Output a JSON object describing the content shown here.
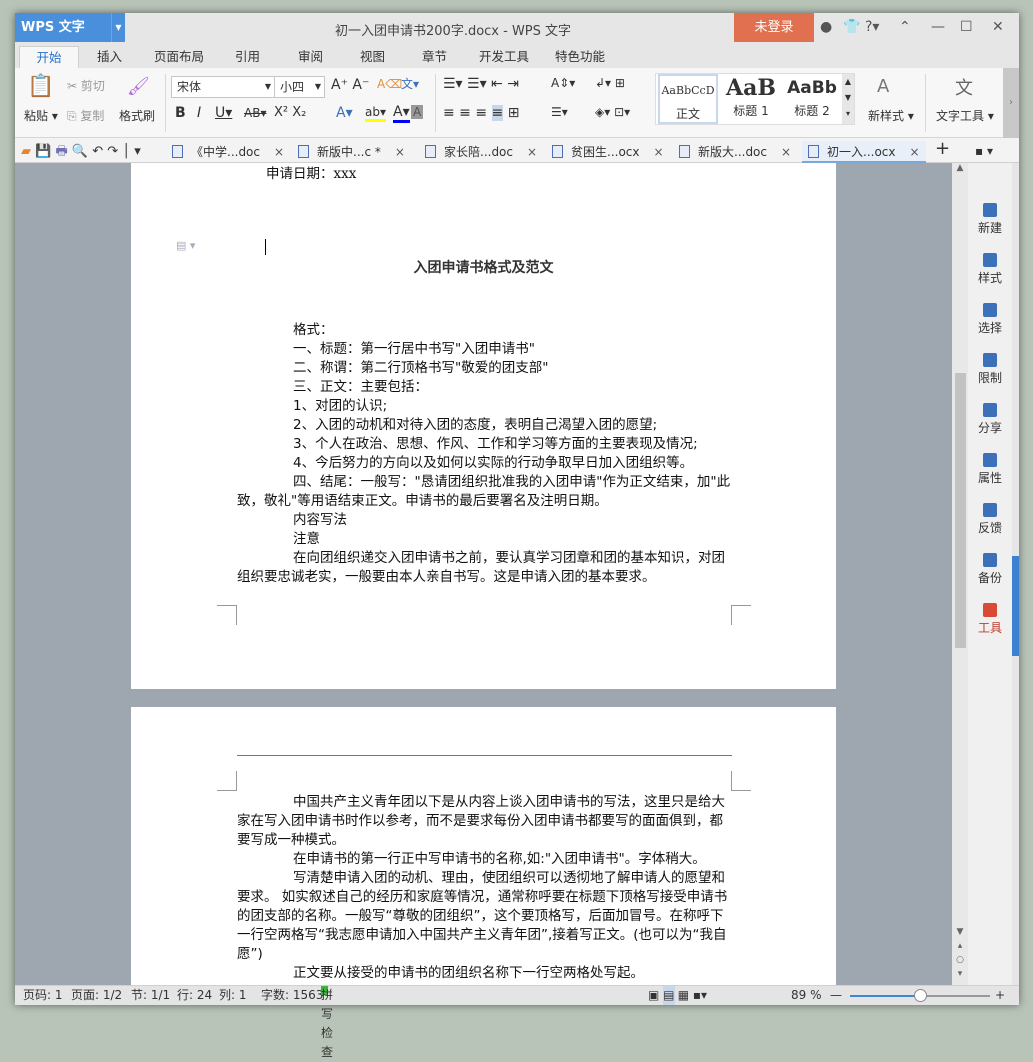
{
  "app": {
    "name": "WPS 文字",
    "window_title": "初一入团申请书200字.docx - WPS 文字",
    "login": "未登录"
  },
  "menu_tabs": [
    "开始",
    "插入",
    "页面布局",
    "引用",
    "审阅",
    "视图",
    "章节",
    "开发工具",
    "特色功能"
  ],
  "ribbon": {
    "paste": "粘贴",
    "cut": "剪切",
    "copy": "复制",
    "format_painter": "格式刷",
    "font": "宋体",
    "size": "小四",
    "styles": [
      {
        "preview": "AaBbCcD",
        "label": "正文"
      },
      {
        "preview": "AaB",
        "label": "标题 1"
      },
      {
        "preview": "AaBb",
        "label": "标题 2"
      }
    ],
    "new_style": "新样式",
    "text_tools": "文字工具"
  },
  "doc_tabs": [
    {
      "label": "《中学...doc"
    },
    {
      "label": "新版中...c *"
    },
    {
      "label": "家长陪...doc"
    },
    {
      "label": "贫困生...ocx"
    },
    {
      "label": "新版大...doc"
    },
    {
      "label": "初一入...ocx"
    }
  ],
  "page1": {
    "date": "申请日期：xxx",
    "title": "入团申请书格式及范文",
    "lines": [
      "格式：",
      "一、标题：第一行居中书写\"入团申请书\"",
      "二、称谓：第二行顶格书写\"敬爱的团支部\"",
      "三、正文：主要包括：",
      "1、对团的认识;",
      "2、入团的动机和对待入团的态度，表明自己渴望入团的愿望;",
      "3、个人在政治、思想、作风、工作和学习等方面的主要表现及情况;",
      "4、今后努力的方向以及如何以实际的行动争取早日加入团组织等。",
      "四、结尾：一般写：\"恳请团组织批准我的入团申请\"作为正文结束，加\"此致，敬礼\"等用语结束正文。申请书的最后要署名及注明日期。",
      "内容写法",
      "注意",
      "在向团组织递交入团申请书之前，要认真学习团章和团的基本知识，对团组织要忠诚老实，一般要由本人亲自书写。这是申请入团的基本要求。"
    ]
  },
  "page2": {
    "lines": [
      "中国共产主义青年团以下是从内容上谈入团申请书的写法，这里只是给大家在写入团申请书时作以参考，而不是要求每份入团申请书都要写的面面俱到，都要写成一种模式。",
      "在申请书的第一行正中写申请书的名称,如:\"入团申请书\"。字体稍大。",
      "写清楚申请入团的动机、理由，使团组织可以透彻地了解申请人的愿望和要求。 如实叙述自己的经历和家庭等情况，通常称呼要在标题下顶格写接受申请书的团支部的名称。一般写“尊敬的团组织”，这个要顶格写，后面加冒号。在称呼下一行空两格写“我志愿申请加入中国共产主义青年团”,接着写正文。(也可以为“我自愿”)",
      "正文要从接受的申请书的团组织名称下一行空两格处写起。"
    ]
  },
  "right_panel": [
    "新建",
    "样式",
    "选择",
    "限制",
    "分享",
    "属性",
    "反馈",
    "备份",
    "工具"
  ],
  "status": {
    "page_no": "页码: 1",
    "pages": "页面: 1/2",
    "section": "节: 1/1",
    "row": "行: 24",
    "col": "列: 1",
    "words": "字数: 1563",
    "spell": "拼写检查",
    "zoom": "89 %",
    "zoom_value": 0.5
  }
}
